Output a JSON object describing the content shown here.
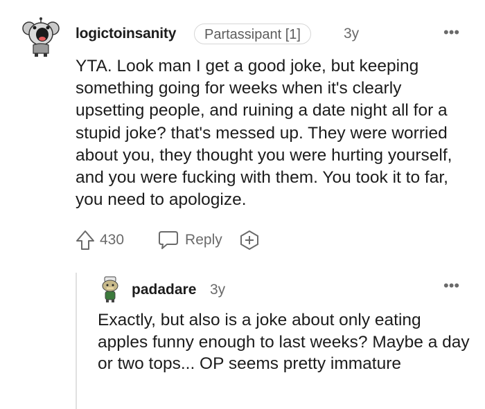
{
  "comment": {
    "username": "logictoinsanity",
    "flair": "Partassipant [1]",
    "age": "3y",
    "more": "•••",
    "body": "YTA. Look man I get a good joke, but keeping something going for weeks when it's clearly upsetting people, and ruining a date night all for a stupid joke? that's messed up. They were worried about you, they thought you were hurting yourself, and you were fucking with them. You took it to far, you need to apologize.",
    "votes": "430",
    "reply_label": "Reply"
  },
  "reply": {
    "username": "padadare",
    "age": "3y",
    "more": "•••",
    "body": "Exactly, but also is a joke about only eating apples funny enough to last weeks? Maybe a day or two tops... OP seems pretty immature"
  },
  "colors": {
    "text": "#1c1c1c",
    "meta": "#6a6a6a",
    "border": "#d6d6d6",
    "thread_line": "#e0e0e0"
  },
  "icons": {
    "upvote": "arrow-up-outline",
    "reply": "speech-bubble",
    "award": "plus-shield",
    "more": "horizontal-ellipsis"
  }
}
